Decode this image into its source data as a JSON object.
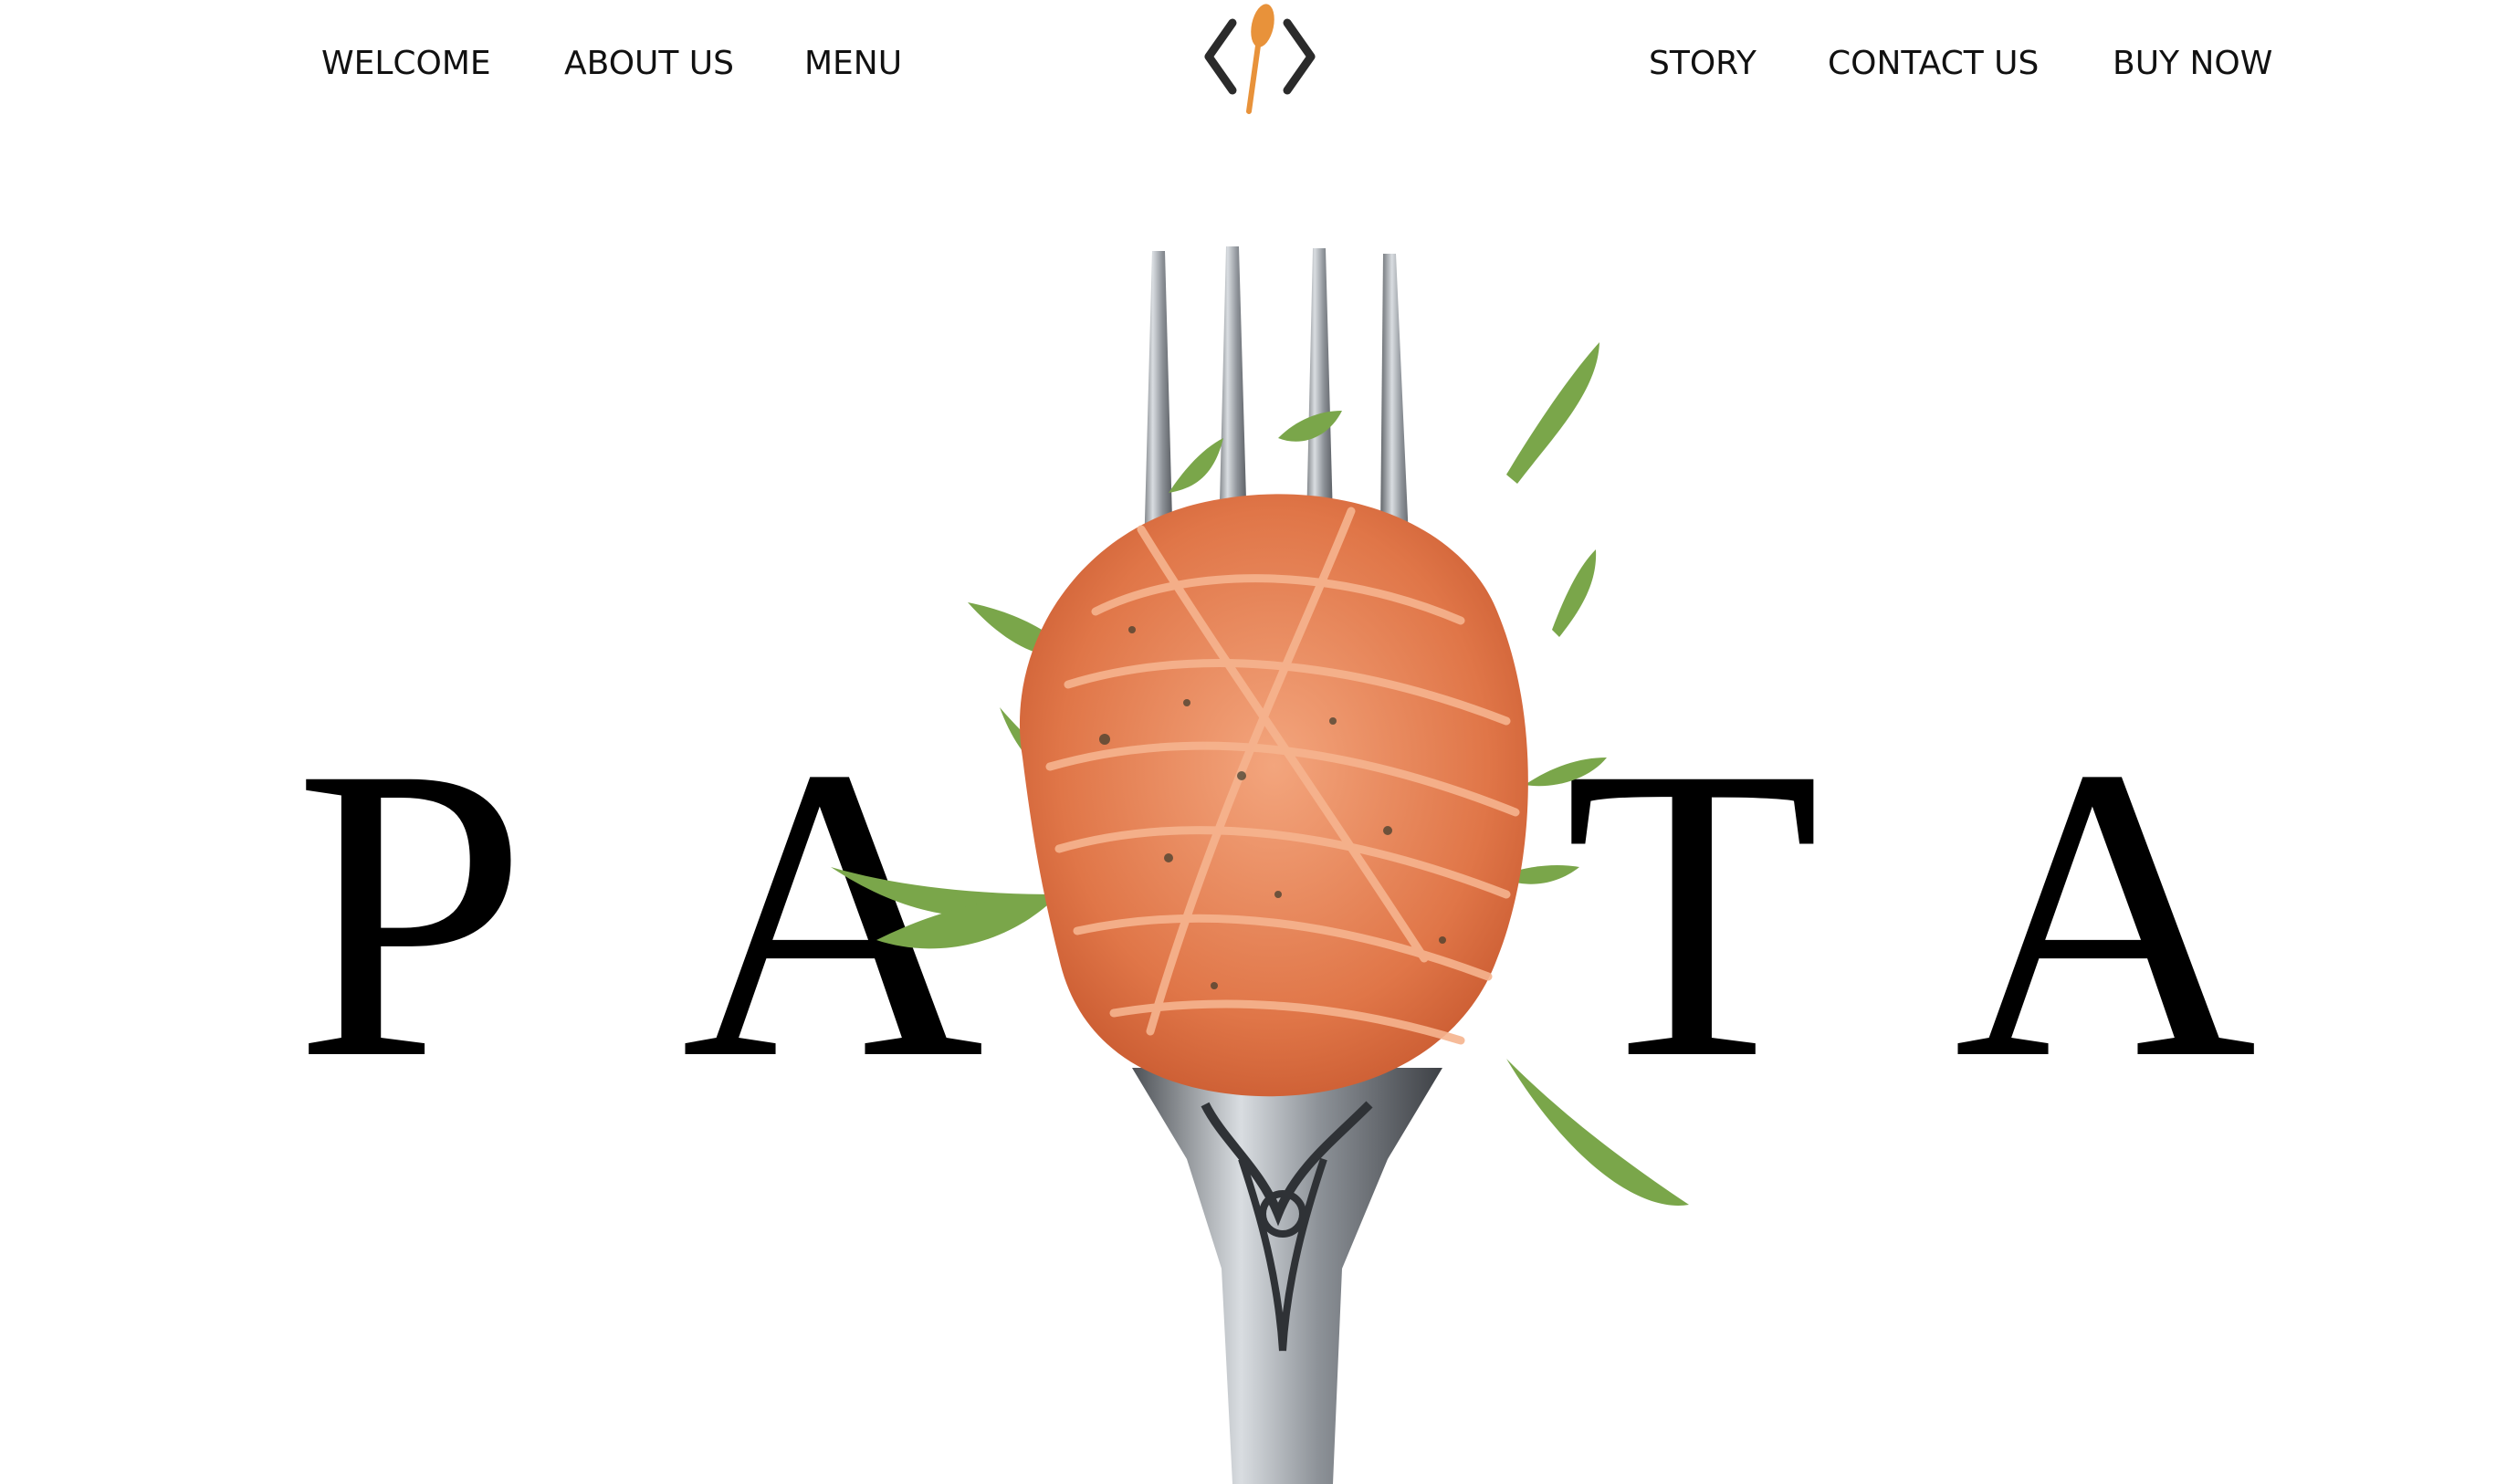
{
  "nav": {
    "left": [
      "WELCOME",
      "ABOUT US",
      "MENU"
    ],
    "right": [
      "STORY",
      "CONTACT US",
      "BUY NOW"
    ]
  },
  "logo": {
    "icon": "code-brackets-spoon-logo",
    "bracket_color": "#2b2b2b",
    "spoon_color": "#e8923a"
  },
  "hero": {
    "visible_letters": [
      "P",
      "A",
      "T",
      "A"
    ],
    "image": "fork-with-spaghetti-and-arugula",
    "colors": {
      "text": "#000000",
      "pasta": "#e27a4a",
      "arugula": "#7aa64a",
      "fork": "#8a8f95"
    }
  }
}
